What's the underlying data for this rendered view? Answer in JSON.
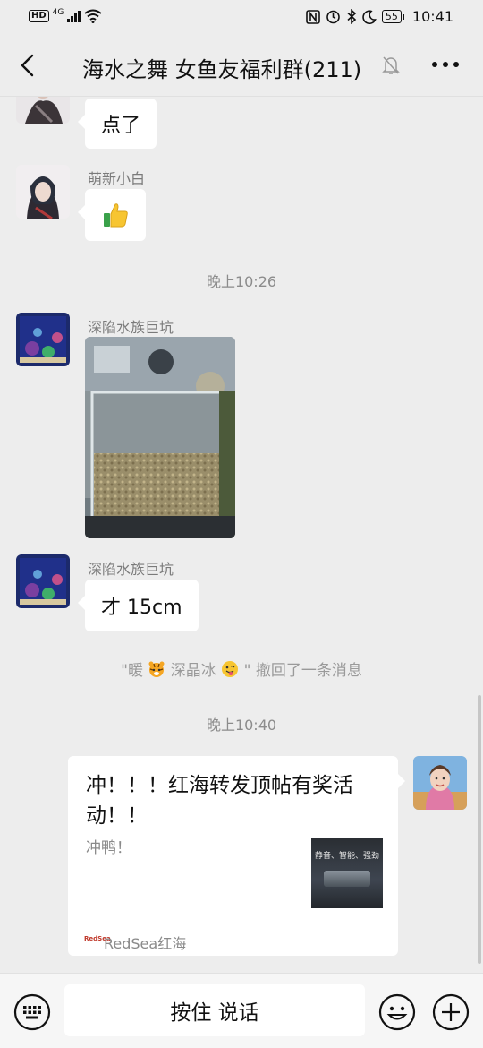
{
  "status": {
    "network_badge": "HD",
    "signal_label": "4G",
    "battery": "55",
    "time": "10:41"
  },
  "header": {
    "title": "海水之舞 女鱼友福利群(211)"
  },
  "messages": {
    "msg1_text": "点了",
    "msg2_sender": "萌新小白",
    "time1": "晚上10:26",
    "msg3_sender": "深陷水族巨坑",
    "msg4_sender": "深陷水族巨坑",
    "msg4_text": "才 15cm",
    "recall_open": "\"暖",
    "recall_name": "深晶冰",
    "recall_close": "\" 撤回了一条消息",
    "time2": "晚上10:40"
  },
  "card": {
    "title": "冲！！！红海转发顶帖有奖活动！！",
    "desc": "冲鸭！",
    "thumb_text": "静音、智能、强劲",
    "source": "RedSea红海",
    "logo_text": "RedSea"
  },
  "bottom": {
    "talk_label": "按住 说话"
  },
  "colors": {
    "background": "#ededed",
    "bubble": "#ffffff",
    "muted_text": "#8c8c8c"
  },
  "icons": [
    "back-arrow-icon",
    "mute-bell-icon",
    "more-dots-icon",
    "thumbs-up-icon",
    "tiger-emoji-icon",
    "tongue-emoji-icon",
    "keyboard-icon",
    "emoji-face-icon",
    "plus-circle-icon"
  ]
}
